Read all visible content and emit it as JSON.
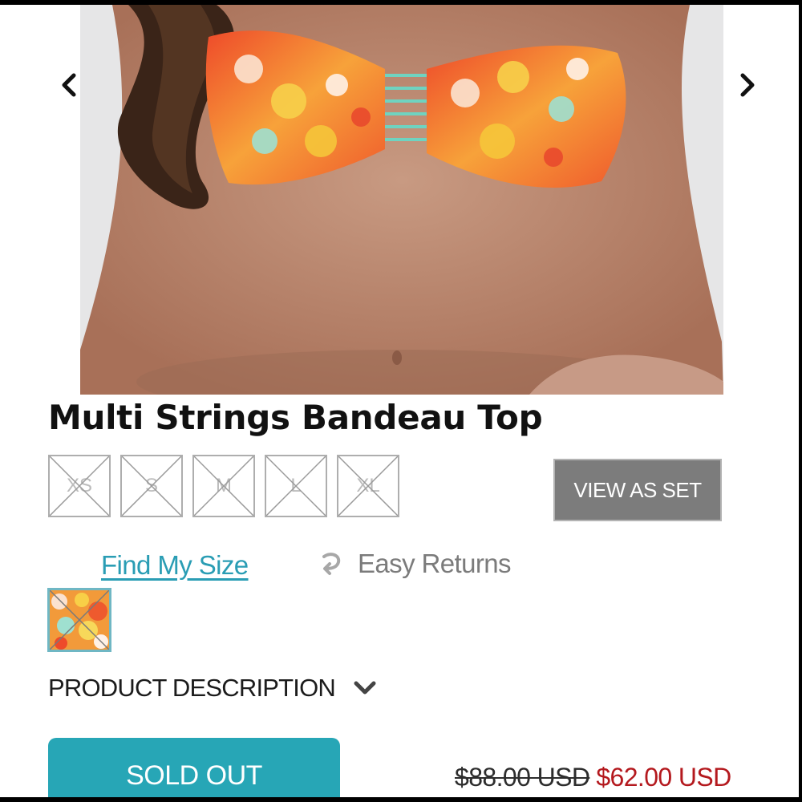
{
  "product": {
    "title": "Multi Strings Bandeau Top",
    "sizes": [
      {
        "label": "XS",
        "available": false
      },
      {
        "label": "S",
        "available": false
      },
      {
        "label": "M",
        "available": false
      },
      {
        "label": "L",
        "available": false
      },
      {
        "label": "XL",
        "available": false
      }
    ],
    "view_as_set_label": "VIEW AS SET",
    "find_size_label": "Find My Size",
    "returns_label": "Easy Returns",
    "description_label": "PRODUCT DESCRIPTION",
    "sold_out_label": "SOLD OUT",
    "price_original": "$88.00 USD",
    "price_sale": "$62.00 USD"
  },
  "gallery": {
    "prev_icon": "chevron-left-icon",
    "next_icon": "chevron-right-icon"
  },
  "colors": {
    "accent": "#27a6b6",
    "link": "#2a9db4",
    "sale": "#b4191e",
    "button_gray": "#7c7c7c"
  }
}
